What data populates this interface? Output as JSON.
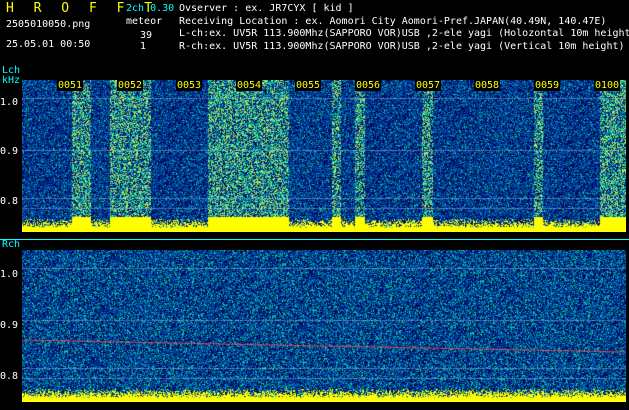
{
  "header": {
    "title": "H R O F F T",
    "filename": "2505010050.png",
    "datetime": "25.05.01 00:50",
    "channel_info": "2ch 0.30",
    "detection_label": "meteor",
    "l_count": "39",
    "r_count": "1"
  },
  "info": {
    "observer": "Ovserver          : ex. JR7CYX [ kid ]",
    "location": "Receiving Location : ex. Aomori City Aomori-Pref.JAPAN(40.49N, 140.47E)",
    "lch": "L-ch:ex. UV5R 113.900Mhz(SAPPORO VOR)USB ,2-ele yagi (Holozontal 10m height)",
    "rch": "R-ch:ex. UV5R 113.900Mhz(SAPPORO VOR)USB ,2-ele yagi (Vertical 10m height)"
  },
  "panels": {
    "left_label": "Lch",
    "unit_label": "kHz",
    "right_label": "Rch",
    "y_ticks": [
      "1.0",
      "0.9",
      "0.8"
    ],
    "time_ticks": [
      "0051",
      "0052",
      "0053",
      "0054",
      "0055",
      "0056",
      "0057",
      "0058",
      "0059",
      "0100"
    ]
  },
  "colors": {
    "background": "#000000",
    "text_yellow": "#ffff00",
    "text_white": "#ffffff",
    "text_cyan": "#00ffff",
    "spectrum_low": "#1030a0",
    "spectrum_high": "#00e0a0",
    "meteor_band": "#ffff00"
  }
}
